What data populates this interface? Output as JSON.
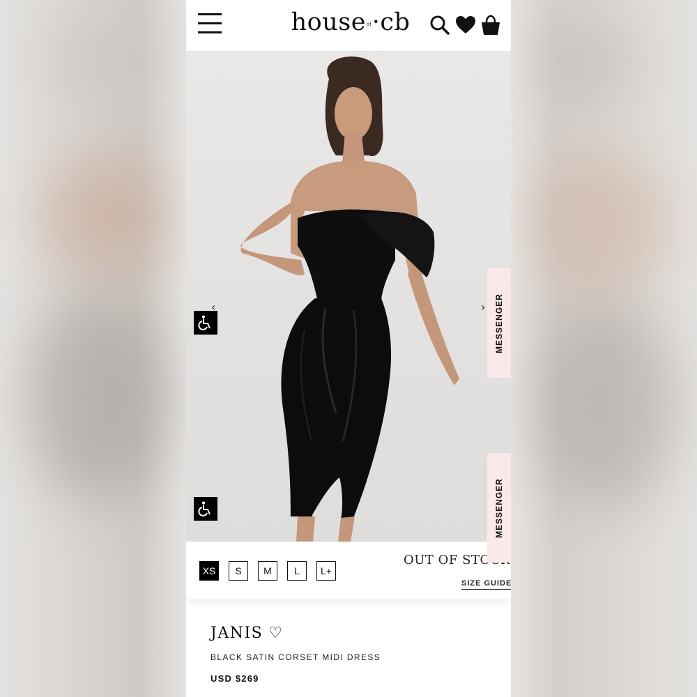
{
  "header": {
    "logo_main": "house",
    "logo_of": "of",
    "logo_cb": "cb",
    "icons": [
      "menu-icon",
      "search-icon",
      "heart-icon",
      "bag-icon"
    ]
  },
  "gallery": {
    "prev_arrow": "‹",
    "next_arrow": "›",
    "messenger_label": "MESSENGER"
  },
  "sizes": {
    "options": [
      "XS",
      "S",
      "M",
      "L",
      "L+"
    ],
    "selected": "XS",
    "status": "OUT OF STOCK",
    "size_guide_label": "SIZE GUIDE"
  },
  "product": {
    "name": "JANIS",
    "wishlist_icon": "♡",
    "description": "BLACK SATIN CORSET MIDI DRESS",
    "price": "USD $269"
  },
  "colors": {
    "accent": "#000000",
    "messenger_bg": "#fbe8e8",
    "image_bg": "#e6e5e4"
  }
}
